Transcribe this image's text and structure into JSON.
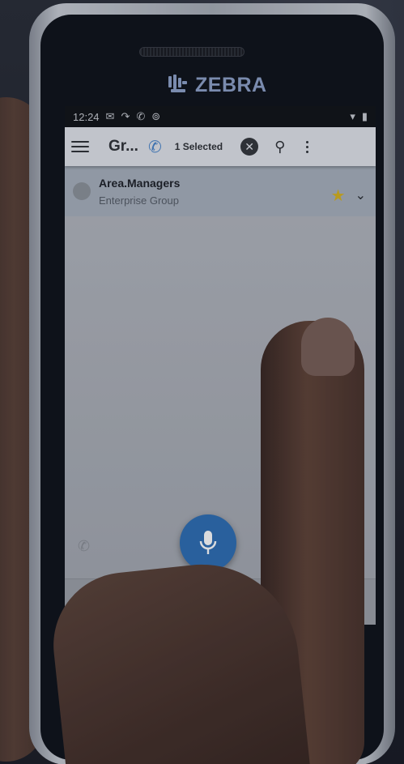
{
  "device": {
    "brand_name": "ZEBRA"
  },
  "status_bar": {
    "time": "12:24"
  },
  "app_bar": {
    "title": "Gr...",
    "selected_text": "1 Selected"
  },
  "list": {
    "items": [
      {
        "name": "Area.Managers",
        "subtitle": "Enterprise Group",
        "favorite": true
      }
    ]
  },
  "colors": {
    "accent_blue": "#2f6fb4",
    "star_yellow": "#d8b322",
    "brand_blue": "#8fa1c8"
  },
  "icons": {
    "menu": "menu-icon",
    "call": "phone-icon",
    "clear_selection": "close-circle-icon",
    "search": "search-icon",
    "more": "more-vert-icon",
    "favorite": "star-icon",
    "expand": "chevron-down-icon",
    "ptt": "microphone-icon"
  }
}
